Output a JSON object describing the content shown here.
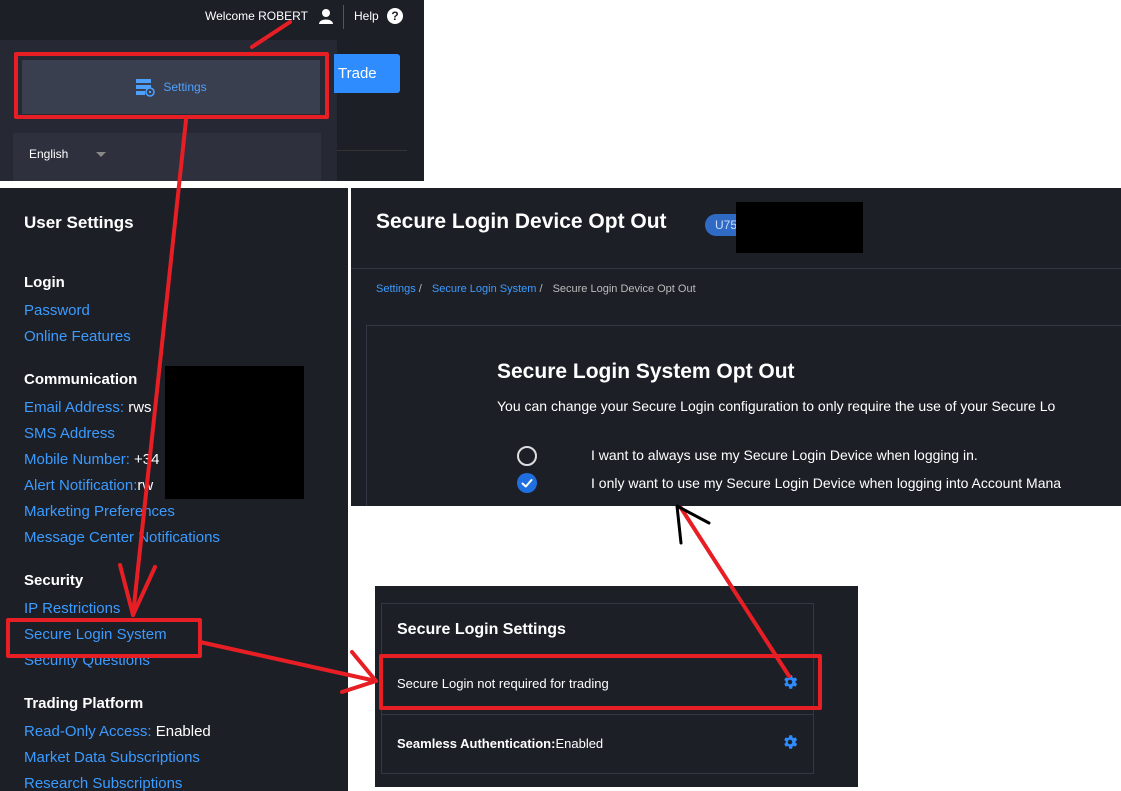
{
  "topbar": {
    "welcome": "Welcome ROBERT",
    "user_icon": "user-icon",
    "help_label": "Help",
    "help_icon_glyph": "?",
    "trade_label": "Trade",
    "settings_label": "Settings",
    "settings_icon": "settings-panel-icon",
    "language": "English"
  },
  "sidebar": {
    "title": "User Settings",
    "sections": [
      {
        "title": "Login",
        "items": [
          {
            "label": "Password",
            "value": ""
          },
          {
            "label": "Online Features",
            "value": ""
          }
        ]
      },
      {
        "title": "Communication",
        "items": [
          {
            "label": "Email Address:",
            "value": " rws"
          },
          {
            "label": "SMS Address",
            "value": ""
          },
          {
            "label": "Mobile Number:",
            "value": " +34"
          },
          {
            "label": "Alert Notification:",
            "value": "rw"
          },
          {
            "label": "Marketing Preferences",
            "value": ""
          },
          {
            "label": "Message Center Notifications",
            "value": ""
          }
        ]
      },
      {
        "title": "Security",
        "items": [
          {
            "label": "IP Restrictions",
            "value": ""
          },
          {
            "label": "Secure Login System",
            "value": ""
          },
          {
            "label": "Security Questions",
            "value": ""
          }
        ]
      },
      {
        "title": "Trading Platform",
        "items": [
          {
            "label": "Read-Only Access:",
            "value": " Enabled"
          },
          {
            "label": "Market Data Subscriptions",
            "value": ""
          },
          {
            "label": "Research Subscriptions",
            "value": ""
          }
        ]
      }
    ]
  },
  "optout": {
    "page_title": "Secure Login Device Opt Out",
    "account_badge": "U75",
    "breadcrumb": [
      "Settings",
      "Secure Login System",
      "Secure Login Device Opt Out"
    ],
    "card_title": "Secure Login System Opt Out",
    "card_desc": "You can change your Secure Login configuration to only require the use of your Secure Lo",
    "options": [
      {
        "label": "I want to always use my Secure Login Device when logging in.",
        "selected": false
      },
      {
        "label": "I only want to use my Secure Login Device when logging into Account Mana",
        "selected": true
      }
    ]
  },
  "secure_login_settings": {
    "title": "Secure Login Settings",
    "rows": [
      {
        "label": "Secure Login not required for trading",
        "value": "",
        "icon": "gear-icon"
      },
      {
        "label": "Seamless Authentication:",
        "value": "Enabled",
        "icon": "gear-icon"
      }
    ]
  },
  "colors": {
    "panel_bg": "#1d1f27",
    "link": "#3b9bff",
    "accent": "#2f8cff",
    "annotation": "#e81e25"
  }
}
